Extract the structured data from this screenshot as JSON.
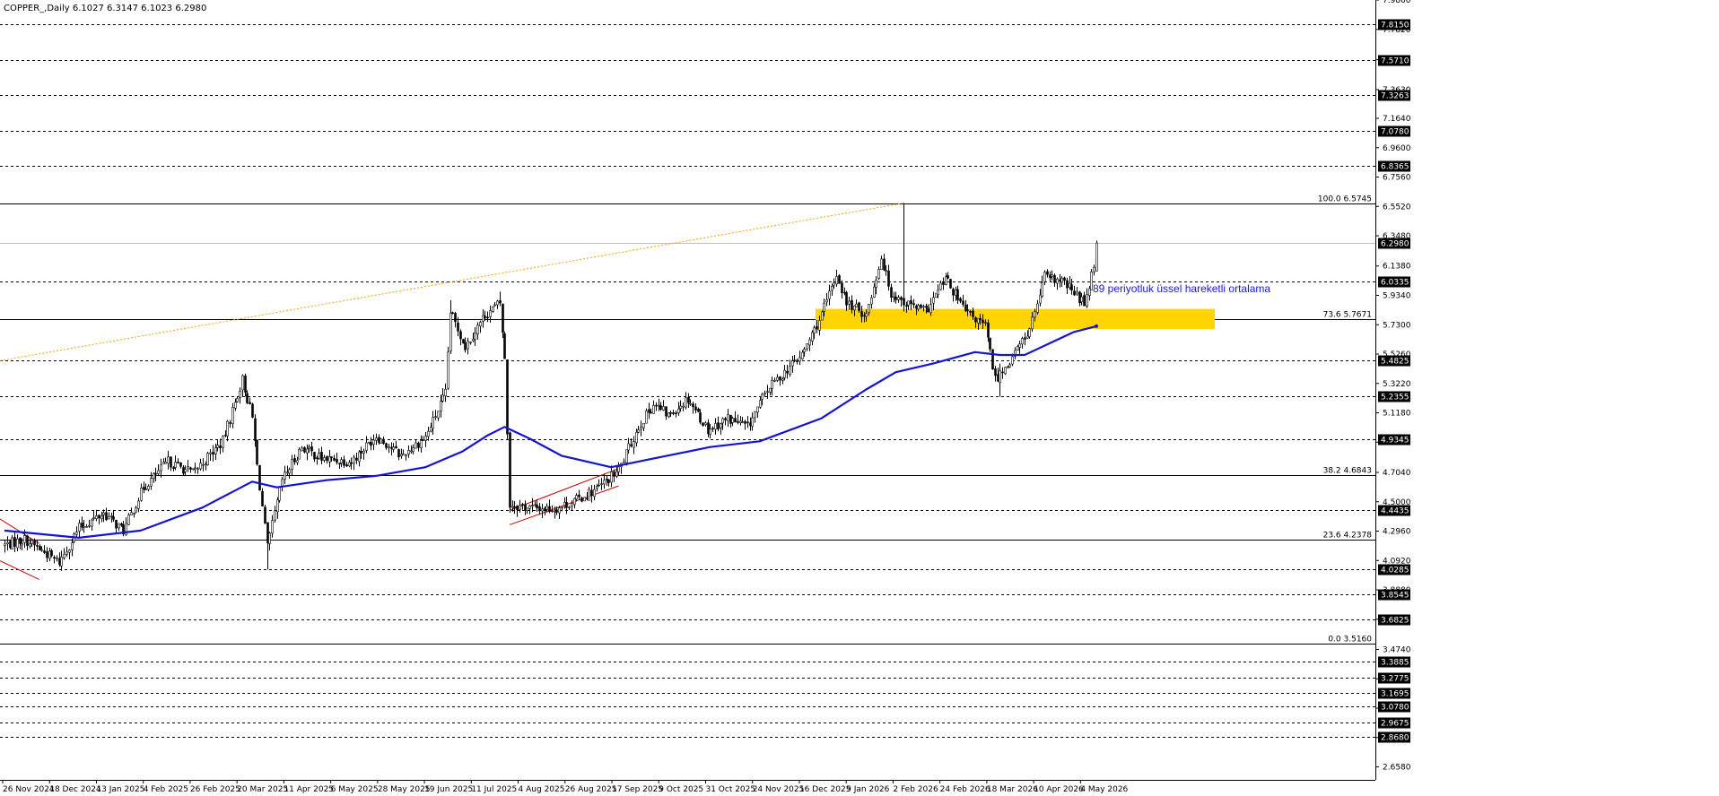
{
  "header": "COPPER_,Daily  6.1027 6.3147 6.1023 6.2980",
  "colors": {
    "background": "#ffffff",
    "candles": "#000000",
    "ema": "#1414d2",
    "zone": "#ffd400",
    "trend_line": "#f0a000",
    "channel": "#cc0000",
    "annotation": "#1a1adc"
  },
  "chart_data": {
    "type": "candlestick",
    "symbol": "COPPER_",
    "timeframe": "Daily",
    "ohlc_last": {
      "open": 6.1027,
      "high": 6.3147,
      "low": 6.1023,
      "close": 6.298
    },
    "x_labels": [
      "26 Nov 2024",
      "18 Dec 2024",
      "13 Jan 2025",
      "4 Feb 2025",
      "26 Feb 2025",
      "20 Mar 2025",
      "11 Apr 2025",
      "6 May 2025",
      "28 May 2025",
      "19 Jun 2025",
      "11 Jul 2025",
      "4 Aug 2025",
      "26 Aug 2025",
      "17 Sep 2025",
      "9 Oct 2025",
      "31 Oct 2025",
      "24 Nov 2025",
      "16 Dec 2025",
      "9 Jan 2026",
      "2 Feb 2026",
      "24 Feb 2026",
      "18 Mar 2026",
      "10 Apr 2026",
      "4 May 2026"
    ],
    "y_range": [
      2.568,
      7.986
    ],
    "y_ticks": [
      "7.9860",
      "7.7820",
      "7.5710",
      "7.3630",
      "7.1640",
      "6.9600",
      "6.7560",
      "6.5520",
      "6.3480",
      "6.1380",
      "5.9340",
      "5.7300",
      "5.5260",
      "5.3220",
      "5.1180",
      "4.9140",
      "4.7040",
      "4.5000",
      "4.2960",
      "4.0920",
      "3.8880",
      "3.6840",
      "3.4740",
      "3.2700",
      "3.0660",
      "2.8620",
      "2.6580"
    ],
    "price_levels": [
      {
        "value": 7.815,
        "label": "7.8150"
      },
      {
        "value": 7.571,
        "label": "7.5710"
      },
      {
        "value": 7.3263,
        "label": "7.3263"
      },
      {
        "value": 7.078,
        "label": "7.0780"
      },
      {
        "value": 6.8365,
        "label": "6.8365"
      },
      {
        "value": 6.0335,
        "label": "6.0335"
      },
      {
        "value": 5.4825,
        "label": "5.4825"
      },
      {
        "value": 5.2355,
        "label": "5.2355"
      },
      {
        "value": 4.9345,
        "label": "4.9345"
      },
      {
        "value": 4.4435,
        "label": "4.4435"
      },
      {
        "value": 4.0285,
        "label": "4.0285"
      },
      {
        "value": 3.8545,
        "label": "3.8545"
      },
      {
        "value": 3.6825,
        "label": "3.6825"
      },
      {
        "value": 3.3885,
        "label": "3.3885"
      },
      {
        "value": 3.2775,
        "label": "3.2775"
      },
      {
        "value": 3.1695,
        "label": "3.1695"
      },
      {
        "value": 3.078,
        "label": "3.0780"
      },
      {
        "value": 2.9675,
        "label": "2.9675"
      },
      {
        "value": 2.868,
        "label": "2.8680"
      }
    ],
    "current_price": {
      "value": 6.298,
      "label": "6.2980"
    },
    "fib_levels": [
      {
        "value": 6.5745,
        "label": "100.0 6.5745"
      },
      {
        "value": 5.7671,
        "label": "73.6 5.7671"
      },
      {
        "value": 4.6843,
        "label": "38.2 4.6843"
      },
      {
        "value": 4.2378,
        "label": "23.6 4.2378"
      },
      {
        "value": 3.516,
        "label": "0.0 3.5160"
      }
    ],
    "support_zone": {
      "from": 5.7,
      "to": 5.84
    },
    "ema_label": "89 periyotluk üssel hareketli ortalama",
    "ema_period": 89,
    "series_anchors": [
      [
        0,
        4.2
      ],
      [
        8,
        4.24
      ],
      [
        16,
        4.15
      ],
      [
        22,
        4.08
      ],
      [
        30,
        4.32
      ],
      [
        40,
        4.42
      ],
      [
        48,
        4.3
      ],
      [
        56,
        4.6
      ],
      [
        66,
        4.78
      ],
      [
        76,
        4.7
      ],
      [
        88,
        4.92
      ],
      [
        96,
        5.35
      ],
      [
        100,
        5.08
      ],
      [
        102,
        4.75
      ],
      [
        106,
        4.18
      ],
      [
        112,
        4.65
      ],
      [
        120,
        4.88
      ],
      [
        128,
        4.8
      ],
      [
        140,
        4.78
      ],
      [
        150,
        4.96
      ],
      [
        160,
        4.82
      ],
      [
        170,
        4.95
      ],
      [
        178,
        5.25
      ],
      [
        180,
        5.82
      ],
      [
        186,
        5.58
      ],
      [
        194,
        5.8
      ],
      [
        200,
        5.88
      ],
      [
        202,
        5.48
      ],
      [
        204,
        4.48
      ],
      [
        212,
        4.46
      ],
      [
        222,
        4.45
      ],
      [
        232,
        4.52
      ],
      [
        240,
        4.6
      ],
      [
        248,
        4.72
      ],
      [
        256,
        5.02
      ],
      [
        262,
        5.18
      ],
      [
        268,
        5.1
      ],
      [
        276,
        5.22
      ],
      [
        284,
        5.0
      ],
      [
        292,
        5.08
      ],
      [
        300,
        5.02
      ],
      [
        308,
        5.28
      ],
      [
        316,
        5.42
      ],
      [
        322,
        5.52
      ],
      [
        330,
        5.8
      ],
      [
        336,
        6.08
      ],
      [
        340,
        5.88
      ],
      [
        348,
        5.8
      ],
      [
        354,
        6.2
      ],
      [
        358,
        5.95
      ],
      [
        364,
        5.88
      ],
      [
        372,
        5.82
      ],
      [
        380,
        6.05
      ],
      [
        388,
        5.82
      ],
      [
        396,
        5.72
      ],
      [
        400,
        5.35
      ],
      [
        406,
        5.48
      ],
      [
        414,
        5.7
      ],
      [
        420,
        6.06
      ],
      [
        428,
        6.02
      ],
      [
        436,
        5.88
      ],
      [
        440,
        6.15
      ],
      [
        442,
        6.29
      ]
    ],
    "ema_anchors": [
      [
        0,
        4.3
      ],
      [
        30,
        4.25
      ],
      [
        55,
        4.3
      ],
      [
        80,
        4.46
      ],
      [
        100,
        4.64
      ],
      [
        110,
        4.6
      ],
      [
        130,
        4.65
      ],
      [
        150,
        4.68
      ],
      [
        170,
        4.74
      ],
      [
        185,
        4.85
      ],
      [
        195,
        4.96
      ],
      [
        202,
        5.02
      ],
      [
        212,
        4.94
      ],
      [
        225,
        4.82
      ],
      [
        245,
        4.74
      ],
      [
        262,
        4.8
      ],
      [
        285,
        4.88
      ],
      [
        305,
        4.92
      ],
      [
        330,
        5.08
      ],
      [
        348,
        5.28
      ],
      [
        360,
        5.4
      ],
      [
        375,
        5.46
      ],
      [
        392,
        5.54
      ],
      [
        402,
        5.52
      ],
      [
        412,
        5.52
      ],
      [
        422,
        5.6
      ],
      [
        432,
        5.68
      ],
      [
        441,
        5.72
      ]
    ],
    "n_bars": 442
  }
}
